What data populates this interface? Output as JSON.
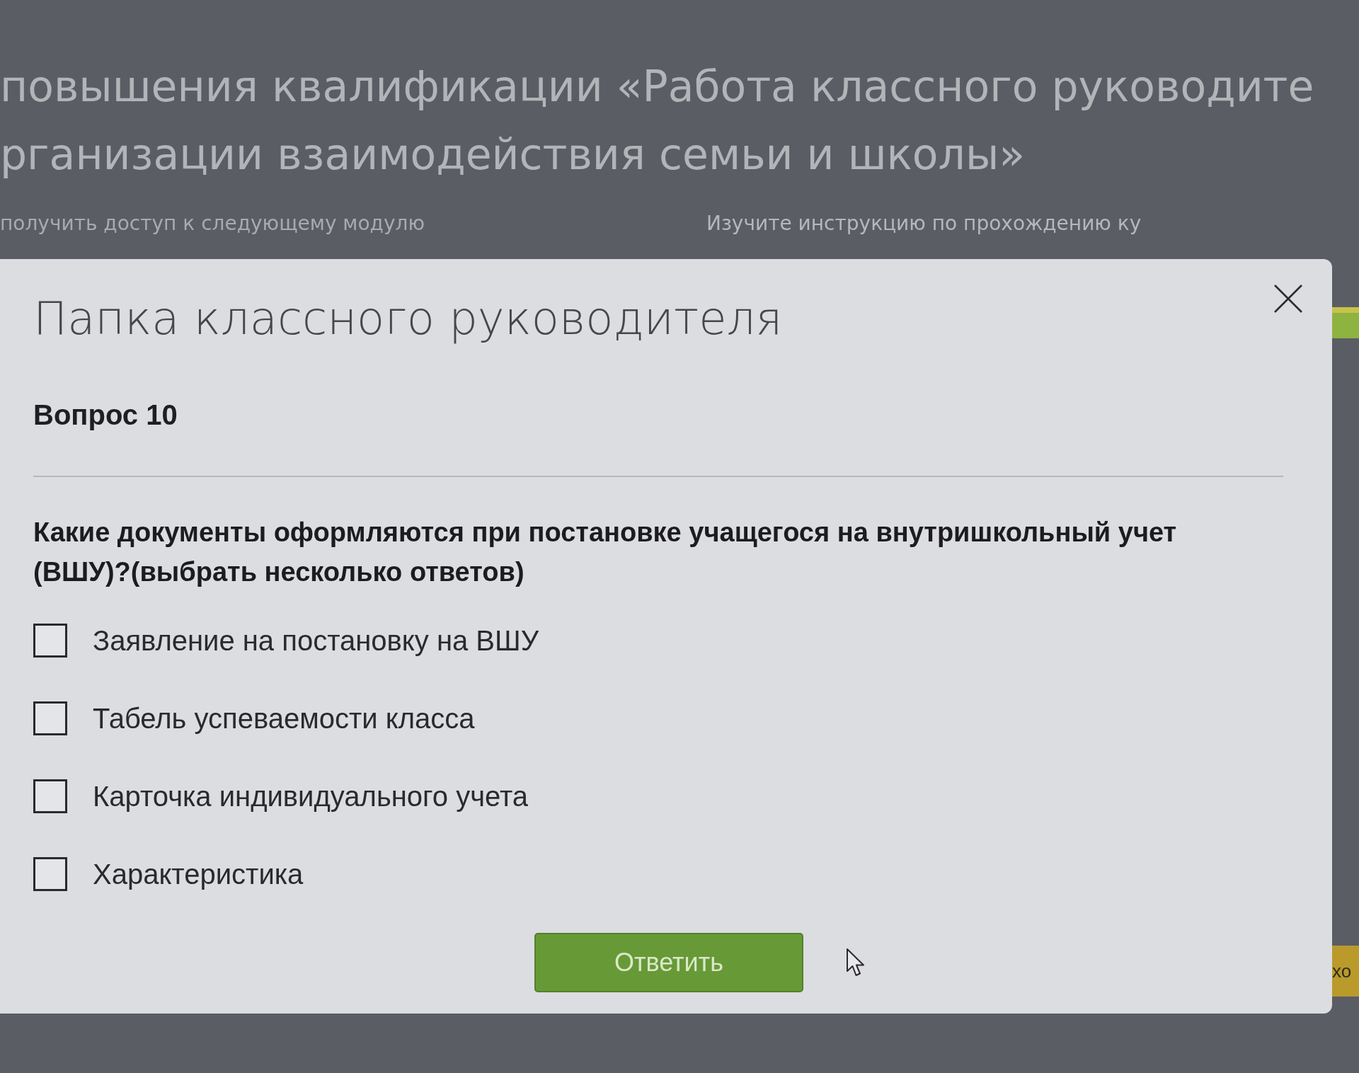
{
  "page": {
    "heading_lines": [
      "повышения квалификации «Работа классного руководите",
      "рганизации взаимодействия семьи и школы»"
    ],
    "notice": "получить доступ к следующему модулю",
    "instruction": "Изучите инструкцию по прохождению ку",
    "side_button": "хо"
  },
  "modal": {
    "title": "Папка классного руководителя",
    "question_number": "Вопрос 10",
    "question": "Какие документы оформляются при постановке учащегося на внутришкольный учет (ВШУ)?(выбрать несколько ответов)",
    "options": [
      {
        "label": "Заявление на постановку на ВШУ",
        "checked": false
      },
      {
        "label": "Табель успеваемости класса",
        "checked": false
      },
      {
        "label": "Карточка индивидуального учета",
        "checked": false
      },
      {
        "label": "Характеристика",
        "checked": false
      }
    ],
    "submit_button": "Ответить"
  }
}
